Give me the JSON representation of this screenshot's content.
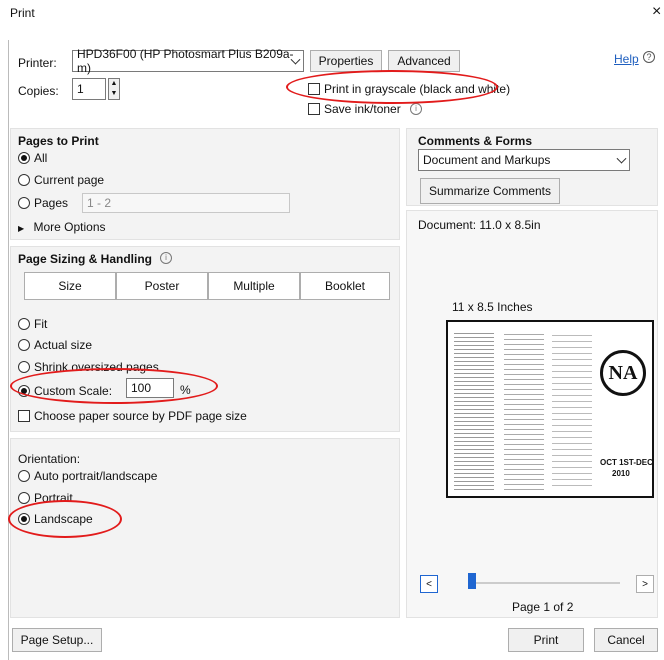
{
  "window": {
    "title": "Print",
    "close_glyph": "×"
  },
  "printer": {
    "label": "Printer:",
    "value": "HPD36F00 (HP Photosmart Plus B209a-m)",
    "properties": "Properties",
    "advanced": "Advanced",
    "help": "Help"
  },
  "copies": {
    "label": "Copies:",
    "value": "1"
  },
  "options": {
    "grayscale": "Print in grayscale (black and white)",
    "save_ink": "Save ink/toner"
  },
  "pages_to_print": {
    "heading": "Pages to Print",
    "all": "All",
    "current": "Current page",
    "pages": "Pages",
    "pages_placeholder": "1 - 2",
    "more": "More Options"
  },
  "sizing": {
    "heading": "Page Sizing & Handling",
    "size": "Size",
    "poster": "Poster",
    "multiple": "Multiple",
    "booklet": "Booklet",
    "fit": "Fit",
    "actual": "Actual size",
    "shrink": "Shrink oversized pages",
    "custom": "Custom Scale:",
    "custom_value": "100",
    "percent": "%",
    "paper_source": "Choose paper source by PDF page size"
  },
  "orientation": {
    "heading": "Orientation:",
    "auto": "Auto portrait/landscape",
    "portrait": "Portrait",
    "landscape": "Landscape"
  },
  "comments": {
    "heading": "Comments & Forms",
    "value": "Document and Markups",
    "summarize": "Summarize Comments"
  },
  "preview": {
    "document": "Document: 11.0 x 8.5in",
    "size_label": "11 x 8.5 Inches",
    "page": "Page 1 of 2",
    "na_logo": "NA",
    "dates": "OCT 1ST-DEC",
    "year": "2010"
  },
  "footer": {
    "page_setup": "Page Setup...",
    "print": "Print",
    "cancel": "Cancel"
  },
  "colors": {
    "annotation": "#e21b1b",
    "link": "#1f5fbf",
    "slider": "#1f66d1"
  }
}
